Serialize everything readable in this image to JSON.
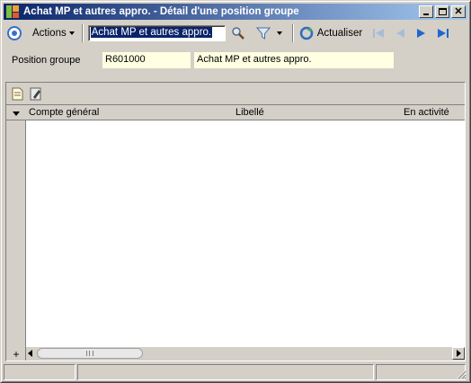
{
  "window": {
    "title": "Achat MP et autres appro. -  Détail d'une position groupe"
  },
  "toolbar": {
    "actions_label": "Actions",
    "search_value": "Achat MP et autres appro.",
    "refresh_label": "Actualiser"
  },
  "form": {
    "position_label": "Position groupe",
    "position_code": "R601000",
    "position_description": "Achat MP et autres appro."
  },
  "grid": {
    "columns": [
      "Compte général",
      "Libellé",
      "En activité"
    ],
    "rows": []
  },
  "colors": {
    "title_start": "#0a246a",
    "title_end": "#a6caf0",
    "field_bg": "#ffffe1",
    "accent_blue": "#3a6fc9"
  }
}
